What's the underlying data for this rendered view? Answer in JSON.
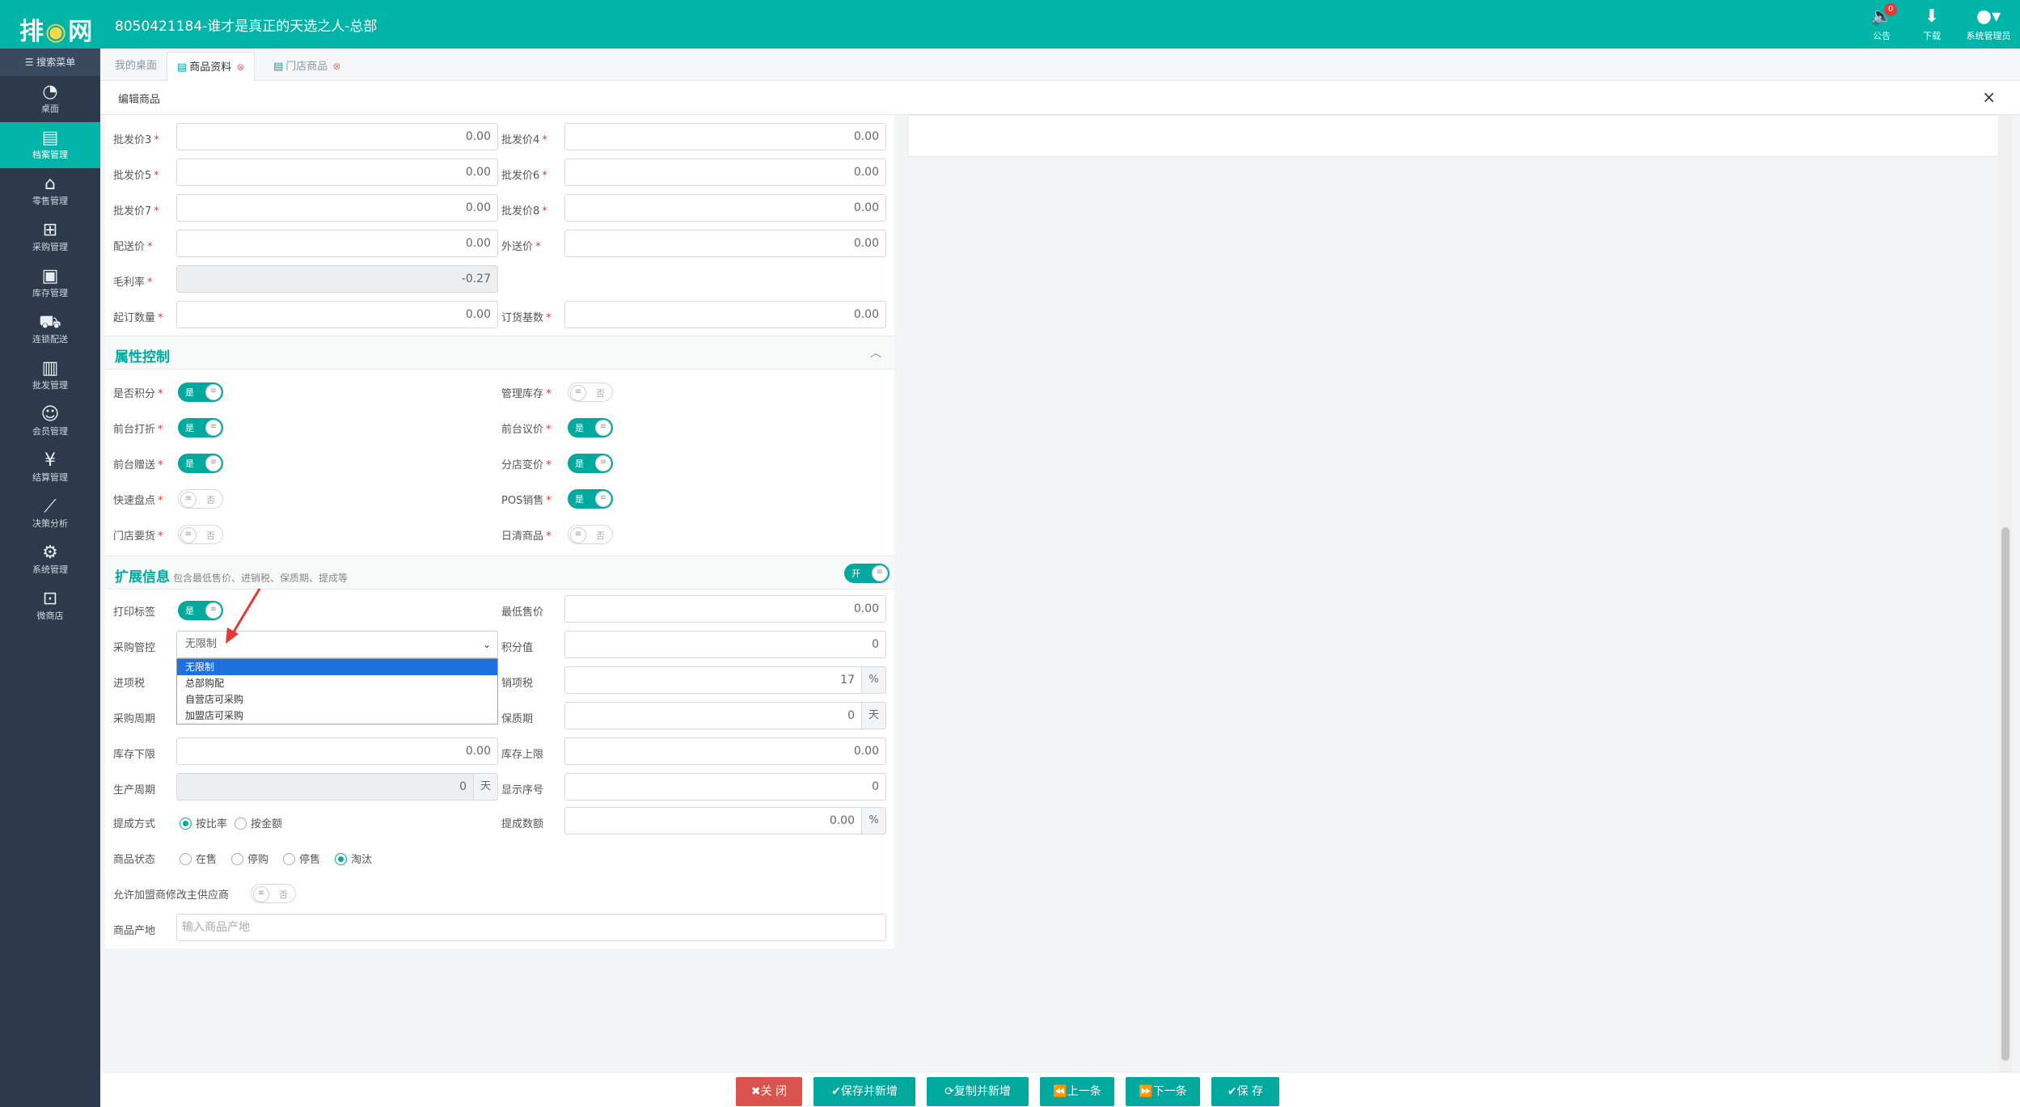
{
  "app": {
    "logo_main": "排",
    "logo_dot": "",
    "logo_rest": "网",
    "logo_full": "排 网",
    "title": "8050421184-谁才是真正的天选之人-总部"
  },
  "top_actions": {
    "notice_label": "公告",
    "notice_badge": "0",
    "download_label": "下载",
    "admin_label": "系统管理员"
  },
  "sidebar": {
    "search_label": "搜索菜单",
    "items": [
      {
        "label": "桌面",
        "icon": "dashboard-icon"
      },
      {
        "label": "档案管理",
        "icon": "archive-icon"
      },
      {
        "label": "零售管理",
        "icon": "store-icon"
      },
      {
        "label": "采购管理",
        "icon": "purchase-icon"
      },
      {
        "label": "库存管理",
        "icon": "inventory-icon"
      },
      {
        "label": "连锁配送",
        "icon": "truck-icon"
      },
      {
        "label": "批发管理",
        "icon": "wholesale-icon"
      },
      {
        "label": "会员管理",
        "icon": "member-icon"
      },
      {
        "label": "结算管理",
        "icon": "settlement-icon"
      },
      {
        "label": "决策分析",
        "icon": "chart-icon"
      },
      {
        "label": "系统管理",
        "icon": "gear-icon"
      },
      {
        "label": "微商店",
        "icon": "shop-icon"
      }
    ],
    "active_index": 1
  },
  "tabs": [
    {
      "label": "我的桌面"
    },
    {
      "label": "商品资料"
    },
    {
      "label": "门店商品"
    }
  ],
  "panel": {
    "title": "编辑商品",
    "close": "×"
  },
  "prices": {
    "wholesale3_label": "批发价3",
    "wholesale3": "0.00",
    "wholesale4_label": "批发价4",
    "wholesale4": "0.00",
    "wholesale5_label": "批发价5",
    "wholesale5": "0.00",
    "wholesale6_label": "批发价6",
    "wholesale6": "0.00",
    "wholesale7_label": "批发价7",
    "wholesale7": "0.00",
    "wholesale8_label": "批发价8",
    "wholesale8": "0.00",
    "delivery_label": "配送价",
    "delivery": "0.00",
    "outsend_label": "外送价",
    "outsend": "0.00",
    "margin_label": "毛利率",
    "margin": "-0.27",
    "min_order_label": "起订数量",
    "min_order": "0.00",
    "order_base_label": "订货基数",
    "order_base": "0.00"
  },
  "attr_section": {
    "title": "属性控制",
    "points_label": "是否积分",
    "points": "是",
    "manage_stock_label": "管理库存",
    "manage_stock": "否",
    "front_discount_label": "前台打折",
    "front_discount": "是",
    "front_bargain_label": "前台议价",
    "front_bargain": "是",
    "front_gift_label": "前台赠送",
    "front_gift": "是",
    "branch_price_label": "分店变价",
    "branch_price": "是",
    "quick_count_label": "快速盘点",
    "quick_count": "否",
    "pos_sale_label": "POS销售",
    "pos_sale": "是",
    "store_request_label": "门店要货",
    "store_request": "否",
    "daily_clear_label": "日清商品",
    "daily_clear": "否"
  },
  "ext_section": {
    "title": "扩展信息",
    "subtitle": "包含最低售价、进销税、保质期、提成等",
    "toggle": "开",
    "print_label_label": "打印标签",
    "print_label": "是",
    "min_price_label": "最低售价",
    "min_price": "0.00",
    "purchase_ctrl_label": "采购管控",
    "purchase_ctrl": "无限制",
    "purchase_options": [
      "无限制",
      "总部购配",
      "自营店可采购",
      "加盟店可采购"
    ],
    "points_value_label": "积分值",
    "points_value": "0",
    "input_tax_label": "进项税",
    "sales_tax_label": "销项税",
    "sales_tax": "17",
    "sales_tax_unit": "%",
    "purchase_cycle_label": "采购周期",
    "shelf_life_label": "保质期",
    "shelf_life": "0",
    "shelf_life_unit": "天",
    "stock_min_label": "库存下限",
    "stock_min": "0.00",
    "stock_max_label": "库存上限",
    "stock_max": "0.00",
    "production_cycle_label": "生产周期",
    "production_cycle": "0",
    "production_cycle_unit": "天",
    "display_order_label": "显示序号",
    "display_order": "0",
    "commission_mode_label": "提成方式",
    "commission_by_ratio": "按比率",
    "commission_by_amount": "按金额",
    "commission_value_label": "提成数额",
    "commission_value": "0.00",
    "commission_value_unit": "%",
    "status_label": "商品状态",
    "status_options": [
      "在售",
      "停购",
      "停售",
      "淘汰"
    ],
    "status_selected": "淘汰",
    "allow_franchise_label": "允许加盟商修改主供应商",
    "allow_franchise": "否",
    "origin_label": "商品产地",
    "origin_placeholder": "输入商品产地"
  },
  "footer": {
    "close": "✖关 闭",
    "save_new": "✔保存并新增",
    "copy_new": "⟳复制并新增",
    "prev": "⏪上一条",
    "next": "⏩下一条",
    "save": "✔保 存"
  },
  "colors": {
    "brand": "#00b4a8",
    "sidebar": "#2d3a4b",
    "danger": "#d9534f"
  }
}
